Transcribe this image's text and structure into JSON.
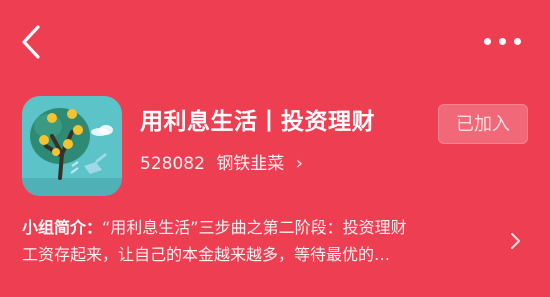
{
  "topbar": {
    "back_icon": "chevron-left-icon",
    "more_icon": "ellipsis-icon"
  },
  "group": {
    "name": "用利息生活丨投资理财",
    "id": "528082",
    "owner": "钢铁韭菜",
    "join_status": "已加入",
    "avatar_icon": "money-tree-icon"
  },
  "intro": {
    "label": "小组简介：",
    "line1": "“用利息生活”三步曲之第二阶段：投资理财",
    "line2": "工资存起来，让自己的本金越来越多，等待最优的…"
  },
  "colors": {
    "background": "#ee3f52",
    "avatar_bg": "#5cc3c8",
    "tree": "#2e8a74"
  }
}
